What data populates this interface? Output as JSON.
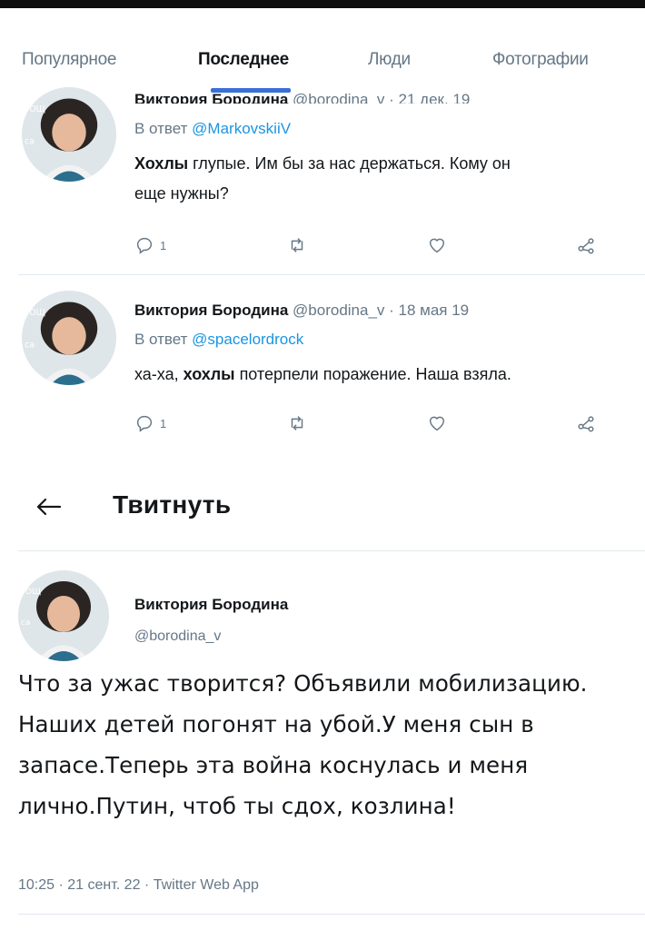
{
  "tabs": {
    "items": [
      "Популярное",
      "Последнее",
      "Люди",
      "Фотографии"
    ]
  },
  "tweet_top": {
    "cut_name": "Виктория Бородина",
    "cut_handle_date": "@borodina_v · 21 дек. 19",
    "reply_prefix": "В ответ ",
    "reply_to": "@MarkovskiiV",
    "text_bold": "Хохлы",
    "text_rest_line1": " глупые. Им бы за нас держаться. Кому он",
    "text_line2": "еще нужны?",
    "reply_count": "1"
  },
  "tweet_second": {
    "name": "Виктория Бородина",
    "handle_date": " @borodina_v · 18 мая 19",
    "reply_prefix": "В ответ ",
    "reply_to": "@spacelordrock",
    "text_pre": "ха-ха, ",
    "text_bold": "хохлы",
    "text_post": " потерпели поражение. Наша взяла.",
    "reply_count": "1"
  },
  "header": {
    "title": "Твитнуть"
  },
  "main_tweet": {
    "name": "Виктория Бородина",
    "handle": "@borodina_v",
    "text": "Что за ужас творится? Объявили мобилизацию. Наших детей погонят на убой.У меня сын в запасе.Теперь эта война коснулась и меня лично.Путин, чтоб ты сдох, козлина!",
    "meta": "10:25 · 21 сент. 22 · Twitter Web App"
  },
  "icons": {
    "reply": "reply-icon",
    "retweet": "retweet-icon",
    "like": "heart-icon",
    "share": "share-icon",
    "back": "back-arrow-icon"
  },
  "colors": {
    "accent": "#3a6fd8",
    "link": "#1b95e0",
    "muted": "#657786",
    "text": "#14171a"
  }
}
